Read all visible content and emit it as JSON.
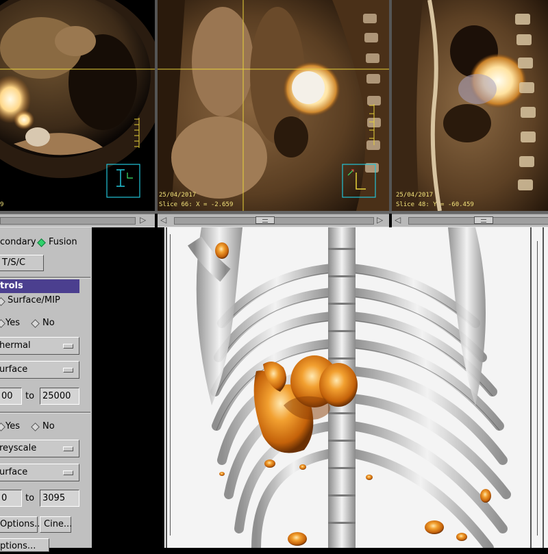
{
  "viewports": [
    {
      "name": "axial",
      "date": "",
      "slice_text": "9"
    },
    {
      "name": "coronal",
      "date": "25/04/2017",
      "slice_text": "Slice 66: X = -2.659"
    },
    {
      "name": "sagittal",
      "date": "25/04/2017",
      "slice_text": "Slice 48: Y = -60.459"
    }
  ],
  "panel": {
    "secondary_label": "condary",
    "fusion_label": "Fusion",
    "tsc_button": "T/S/C",
    "section_title": "trols",
    "surface_mip_label": "Surface/MIP",
    "group1": {
      "yes_label": "Yes",
      "no_label": "No",
      "colormap": "hermal",
      "render_mode": "urface",
      "range_from": "00",
      "to_label": "to",
      "range_to": "25000"
    },
    "group2": {
      "yes_label": "Yes",
      "no_label": "No",
      "colormap": "reyscale",
      "render_mode": "urface",
      "range_from": "0",
      "to_label": "to",
      "range_to": "3095"
    },
    "options_button": "Options...",
    "cine_button": "Cine...",
    "bottom_button": "ptions..."
  },
  "colors": {
    "panel_bg": "#c0c0c0",
    "header_bg": "#4b3f8f",
    "crosshair": "#e8d23a",
    "orient_box": "#22c4d8",
    "fusion_green": "#2fd16b",
    "hot_orange": "#e88a10"
  }
}
